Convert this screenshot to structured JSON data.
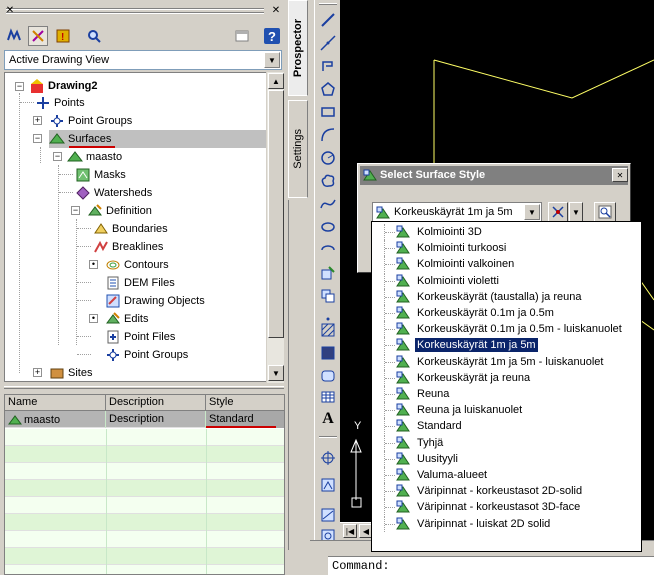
{
  "panel": {
    "view_combo_value": "Active Drawing View",
    "vertical_tabs": [
      "Prospector",
      "Settings"
    ]
  },
  "tree": {
    "root": "Drawing2",
    "points": "Points",
    "point_groups": "Point Groups",
    "surfaces": "Surfaces",
    "surface_name": "maasto",
    "masks": "Masks",
    "watersheds": "Watersheds",
    "definition": "Definition",
    "boundaries": "Boundaries",
    "breaklines": "Breaklines",
    "contours": "Contours",
    "dem_files": "DEM Files",
    "drawing_objects": "Drawing Objects",
    "edits": "Edits",
    "point_files": "Point Files",
    "def_point_groups": "Point Groups",
    "sites": "Sites"
  },
  "grid": {
    "headers": [
      "Name",
      "Description",
      "Style"
    ],
    "row": {
      "name": "maasto",
      "description": "Description",
      "style": "Standard"
    }
  },
  "dialog": {
    "title": "Select Surface Style",
    "combo_value": "Korkeuskäyrät 1m ja 5m",
    "close_label": "✕"
  },
  "style_options": [
    "Kolmiointi 3D",
    "Kolmiointi turkoosi",
    "Kolmiointi valkoinen",
    "Kolmiointi violetti",
    "Korkeuskäyrät (taustalla) ja reuna",
    "Korkeuskäyrät 0.1m ja 0.5m",
    "Korkeuskäyrät 0.1m ja 0.5m - luiskanuolet",
    "Korkeuskäyrät 1m ja 5m",
    "Korkeuskäyrät 1m ja 5m - luiskanuolet",
    "Korkeuskäyrät ja reuna",
    "Reuna",
    "Reuna ja luiskanuolet",
    "Standard",
    "Tyhjä",
    "Uusityyli",
    "Valuma-alueet",
    "Väripinnat - korkeustasot 2D-solid",
    "Väripinnat - korkeustasot 3D-face",
    "Väripinnat - luiskat 2D solid"
  ],
  "selected_option_index": 7,
  "canvas": {
    "ucs_label": "Y"
  },
  "command": {
    "prompt": "Command:"
  },
  "colors": {
    "selection": "#0a246a",
    "canvas": "#000000",
    "linework": "#ffff66",
    "accent_underline": "#cc0000"
  }
}
